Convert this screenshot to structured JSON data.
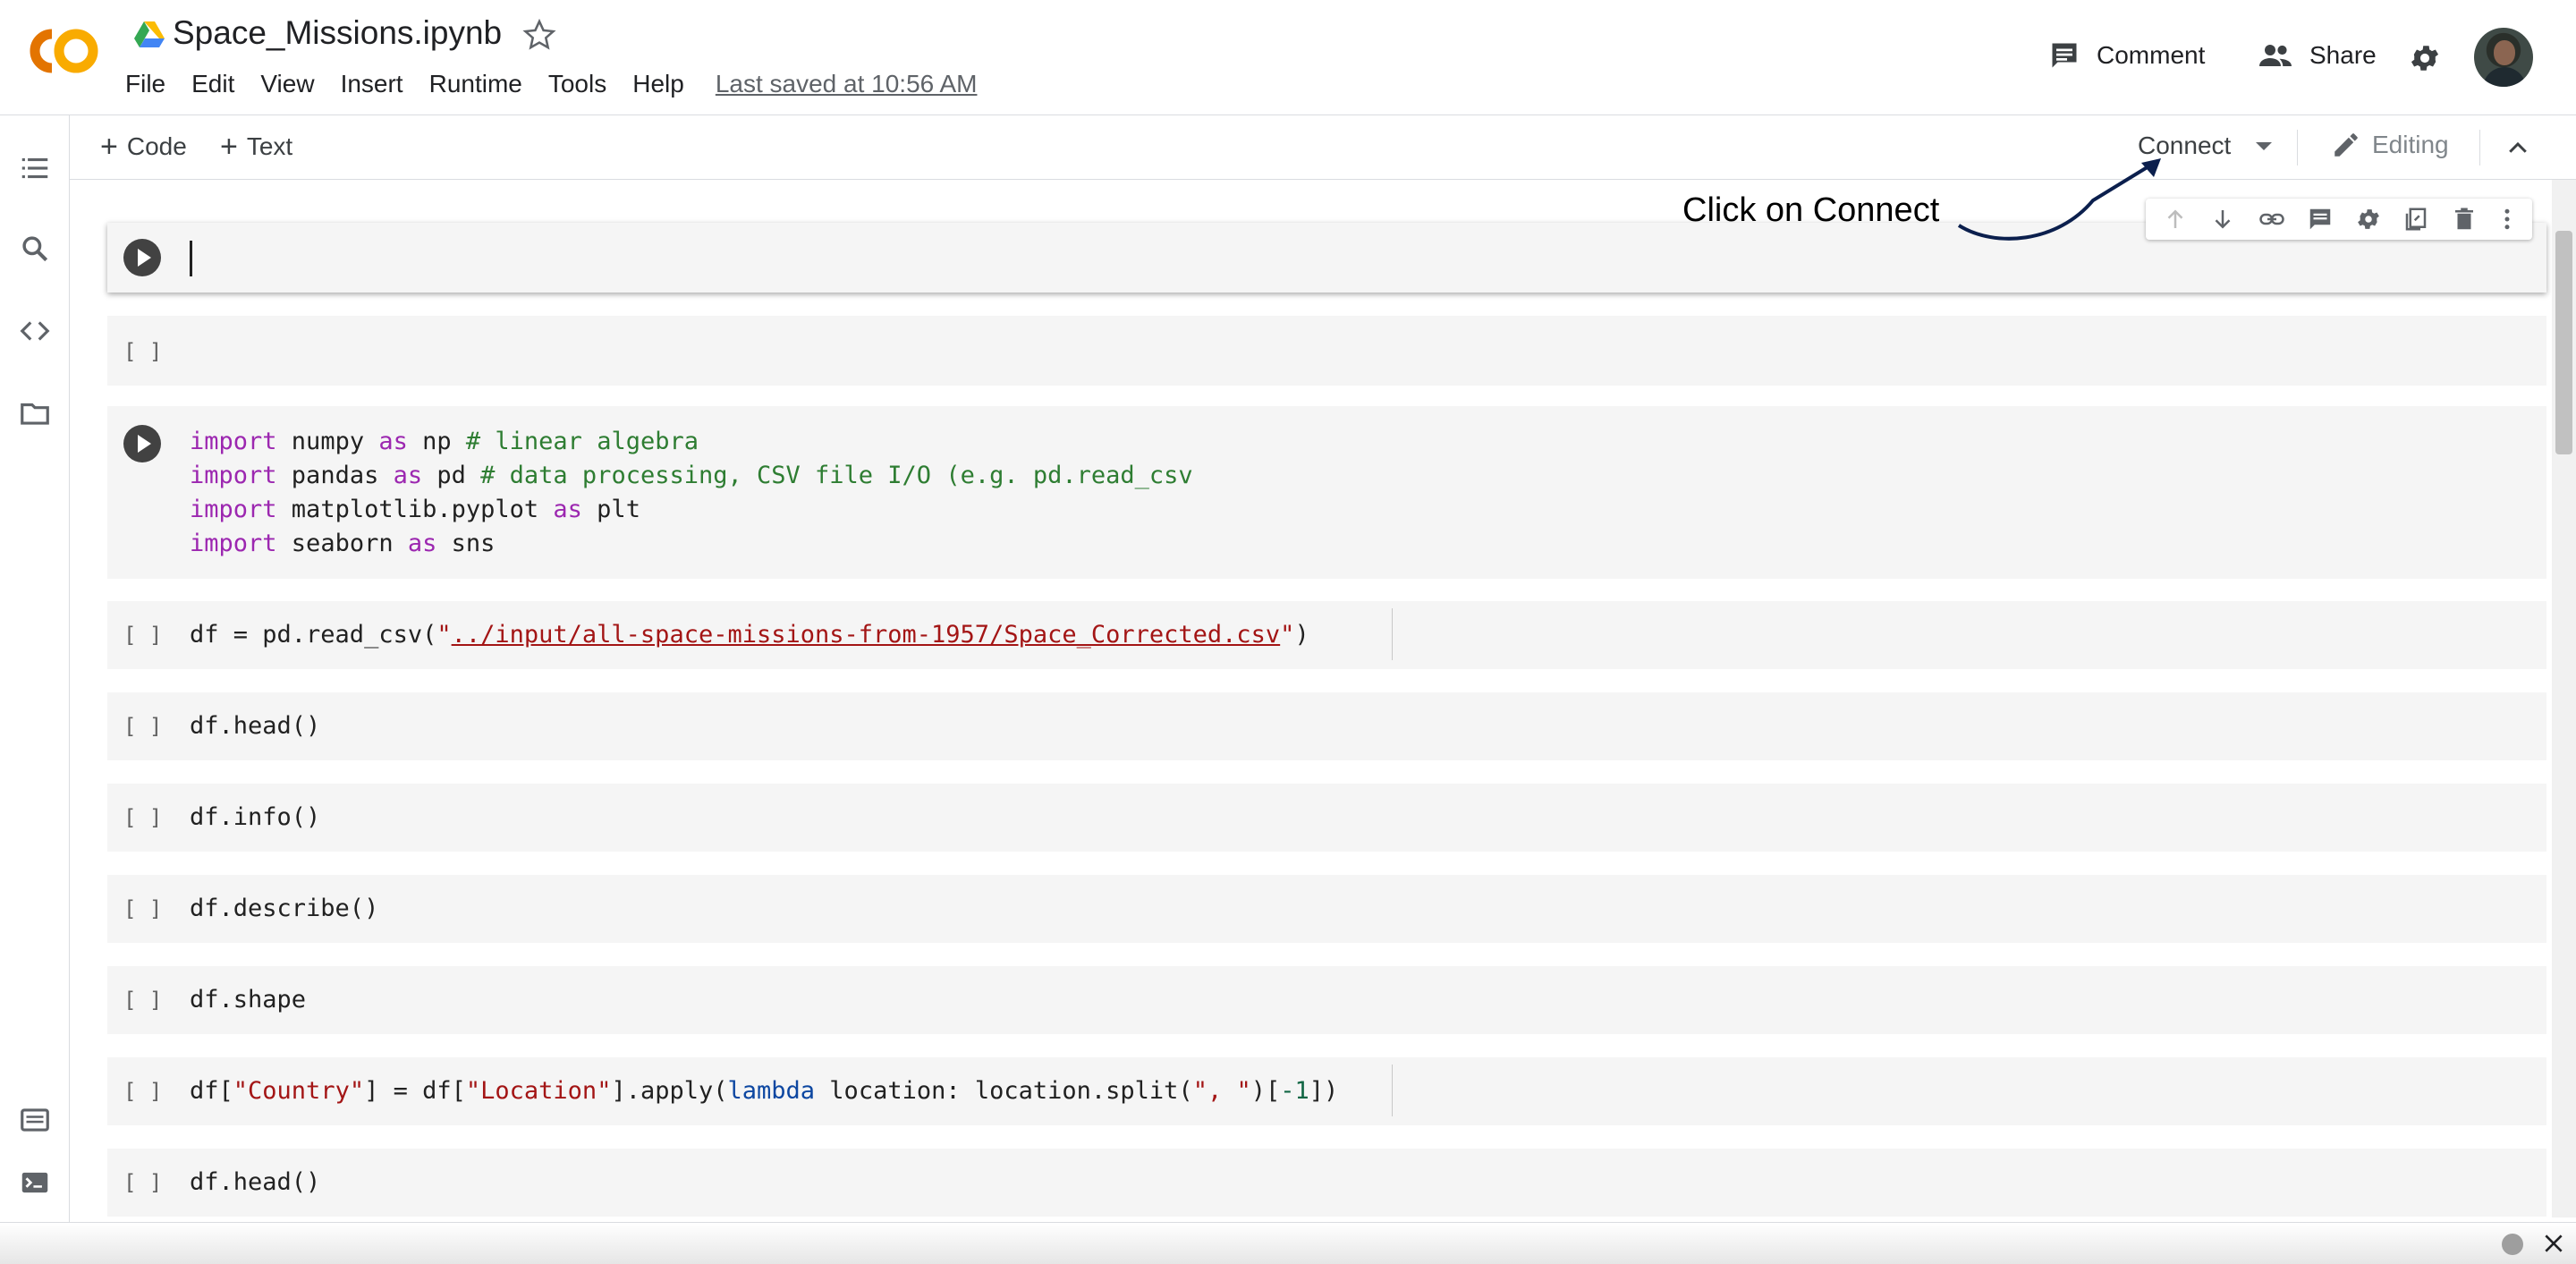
{
  "header": {
    "title": "Space_Missions.ipynb",
    "menu": [
      "File",
      "Edit",
      "View",
      "Insert",
      "Runtime",
      "Tools",
      "Help"
    ],
    "last_saved": "Last saved at 10:56 AM",
    "comment_label": "Comment",
    "share_label": "Share"
  },
  "toolbar": {
    "add_code": "Code",
    "add_text": "Text",
    "connect_label": "Connect",
    "editing_label": "Editing"
  },
  "annotation": {
    "text": "Click on Connect"
  },
  "cells": {
    "empty_bracket": "[ ]",
    "c1_l1": [
      "import",
      " numpy ",
      "as",
      " np ",
      "# linear algebra"
    ],
    "c1_l2": [
      "import",
      " pandas ",
      "as",
      " pd ",
      "# data processing, CSV file I/O (e.g. pd.read_csv"
    ],
    "c1_l3": [
      "import",
      " matplotlib.pyplot ",
      "as",
      " plt"
    ],
    "c1_l4": [
      "import",
      " seaborn ",
      "as",
      " sns"
    ],
    "c2": [
      "df = pd.read_csv(",
      "\"",
      "../input/all-space-missions-from-1957/Space_Corrected.csv",
      "\"",
      ")"
    ],
    "c3": "df.head()",
    "c4": "df.info()",
    "c5": "df.describe()",
    "c6": "df.shape",
    "c7": [
      "df[",
      "\"Country\"",
      "] = df[",
      "\"Location\"",
      "].apply(",
      "lambda",
      " location: location.split(",
      "\", \"",
      ")[",
      "-1",
      "])"
    ],
    "c8": "df.head()"
  },
  "colors": {
    "keyword": "#9c27b0",
    "comment": "#2e7d32",
    "string": "#a31515",
    "lambda": "#0d47a1",
    "logo_orange": "#f9ab00",
    "logo_dark_orange": "#e37400"
  }
}
